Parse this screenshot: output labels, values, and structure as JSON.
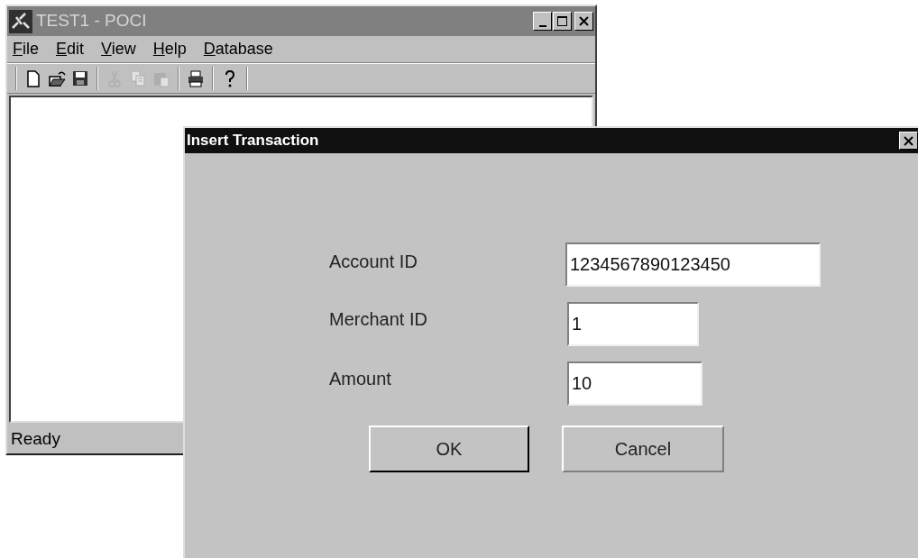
{
  "main_window": {
    "title": "TEST1 - POCI",
    "active": false,
    "menu": [
      "File",
      "Edit",
      "View",
      "Help",
      "Database"
    ],
    "toolbar": [
      {
        "disabled": false
      },
      {
        "disabled": false
      },
      {
        "disabled": false
      },
      {
        "disabled": true
      },
      {
        "disabled": true
      },
      {
        "disabled": true
      },
      {
        "disabled": false
      },
      {
        "disabled": false
      }
    ],
    "status_bar": "Ready"
  },
  "dialog": {
    "title": "Insert Transaction",
    "active": true,
    "fields": [
      {
        "label": "Account ID",
        "value": "1234567890123450"
      },
      {
        "label": "Merchant ID",
        "value": "1"
      },
      {
        "label": "Amount",
        "value": "10"
      }
    ],
    "buttons": [
      "OK",
      "Cancel"
    ]
  }
}
